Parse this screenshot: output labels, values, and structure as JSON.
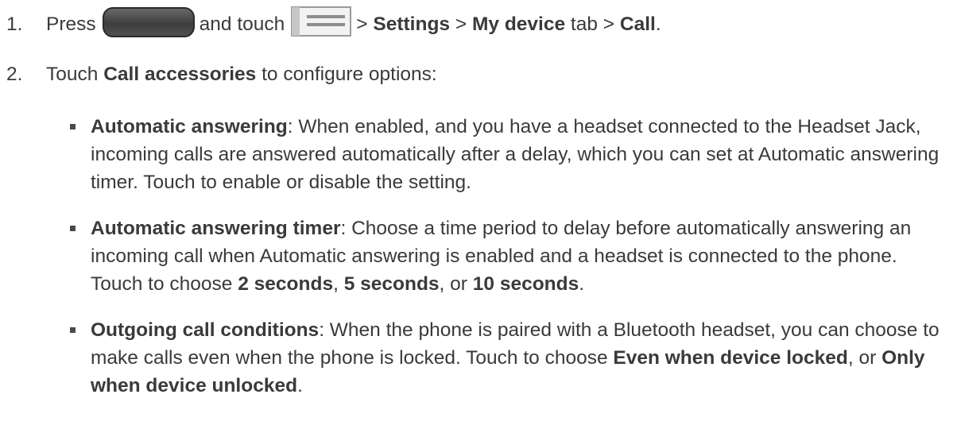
{
  "step1": {
    "number": "1.",
    "press": "Press",
    "home_key_icon": "home-key-icon",
    "and_touch": "and touch",
    "menu_key_icon": "menu-key-icon",
    "sep1": ">",
    "settings": "Settings",
    "sep2": ">",
    "my_device": "My device",
    "tab": "tab",
    "sep3": ">",
    "call": "Call",
    "end": "."
  },
  "step2": {
    "number": "2.",
    "touch": "Touch",
    "call_accessories": "Call accessories",
    "rest": "to configure options:"
  },
  "bullets": [
    {
      "term": "Automatic answering",
      "text": ": When enabled, and you have a headset connected to the Headset Jack, incoming calls are answered automatically after a delay, which you can set at Automatic answering timer. Touch to enable or disable the setting."
    },
    {
      "term": "Automatic answering timer",
      "text": ": Choose a time period to delay before automatically answering an incoming call when Automatic answering is enabled and a headset is connected to the phone. Touch to choose ",
      "opt1": "2 seconds",
      "sep1": ", ",
      "opt2": "5 seconds",
      "sep2": ", or ",
      "opt3": "10 seconds",
      "end": "."
    },
    {
      "term": "Outgoing call conditions",
      "text": ": When the phone is paired with a Bluetooth headset, you can choose to make calls even when the phone is locked. Touch to choose ",
      "opt1": "Even when device locked",
      "sep1": ", or ",
      "opt2": "Only when device unlocked",
      "end": "."
    }
  ]
}
